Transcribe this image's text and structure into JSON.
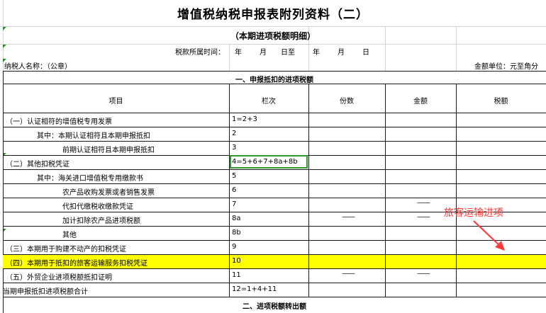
{
  "header": {
    "title": "增值税纳税申报表附列资料（二）",
    "subtitle": "（本期进项税额明细）",
    "period_label": "税款所属时间：",
    "period_parts": [
      "年",
      "月",
      "日至",
      "年",
      "月",
      "日"
    ],
    "taxpayer_label": "纳税人名称：（公章）",
    "unit_label": "金额单位：元至角分"
  },
  "section1_title": "一、申报抵扣的进项税额",
  "section2_title": "二、进项税额转出额",
  "columns": [
    "项目",
    "栏次",
    "份数",
    "金额",
    "税额"
  ],
  "dash": "——",
  "rows": [
    {
      "label": "（一）认证相符的增值税专用发票",
      "code": "1=2+3"
    },
    {
      "label": "其中：本期认证相符且本期申报抵扣",
      "code": "2"
    },
    {
      "label": "前期认证相符且本期申报抵扣",
      "code": "3"
    },
    {
      "label": "（二）其他扣税凭证",
      "code": "4=5+6+7+8a+8b"
    },
    {
      "label": "其中：海关进口增值税专用缴款书",
      "code": "5"
    },
    {
      "label": "农产品收购发票或者销售发票",
      "code": "6"
    },
    {
      "label": "代扣代缴税收缴款凭证",
      "code": "7"
    },
    {
      "label": "加计扣除农产品进项税额",
      "code": "8a"
    },
    {
      "label": "其他",
      "code": "8b"
    },
    {
      "label": "（三）本期用于购建不动产的扣税凭证",
      "code": "9"
    },
    {
      "label": "（四）本期用于抵扣的旅客运输服务扣税凭证",
      "code": "10"
    },
    {
      "label": "（五）外贸企业进项税额抵扣证明",
      "code": "11"
    },
    {
      "label": "当期申报抵扣进项税额合计",
      "code": "12=1+4+11"
    }
  ],
  "annotation": "旅客运输进项",
  "colors": {
    "highlight": "#ffff00",
    "annotation": "#ff3b3b",
    "selection": "#2e9a2e"
  }
}
